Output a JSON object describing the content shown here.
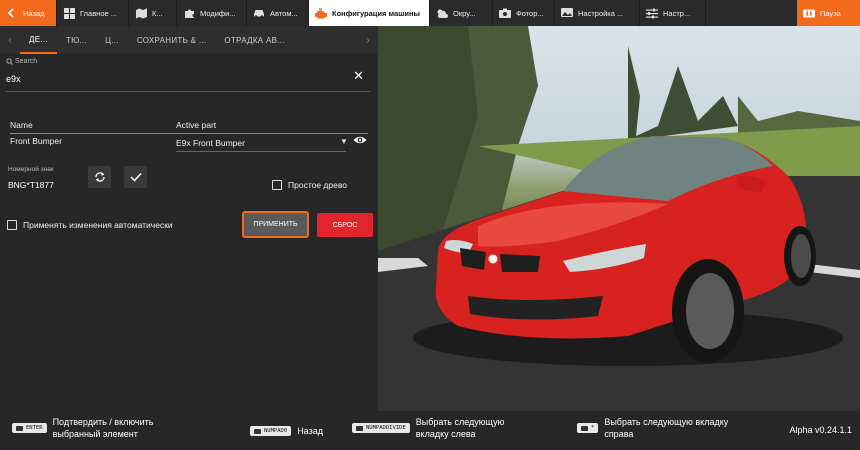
{
  "topbar": {
    "back": "Назад",
    "items": [
      {
        "label": "Главное ...",
        "icon": "grid-icon"
      },
      {
        "label": "К...",
        "icon": "map-icon"
      },
      {
        "label": "Модифи...",
        "icon": "puzzle-icon"
      },
      {
        "label": "Автом...",
        "icon": "car-icon"
      },
      {
        "label": "Конфигурация машины",
        "icon": "engine-icon"
      },
      {
        "label": "Окру...",
        "icon": "weather-icon"
      },
      {
        "label": "Фотор...",
        "icon": "camera-icon"
      },
      {
        "label": "Настройка ...",
        "icon": "photo-settings-icon"
      },
      {
        "label": "Настр...",
        "icon": "sliders-icon"
      }
    ],
    "pause": "Пауза"
  },
  "tabs": [
    "ДЕ...",
    "ТЮ...",
    "Ц...",
    "СОХРАНИТЬ & ...",
    "ОТРАДКА АВ..."
  ],
  "search": {
    "label": "Search",
    "value": "e9x"
  },
  "table": {
    "col_name": "Name",
    "col_part": "Active part",
    "row_name": "Front Bumper",
    "row_part": "E9x Front Bumper"
  },
  "plate": {
    "label": "Номерной знак",
    "value": "BNG*T1877"
  },
  "simple_tree": "Простое древо",
  "auto_apply": "Применять изменения автоматически",
  "apply_button": "ПРИМЕНИТЬ",
  "reset_button": "СБРОС",
  "hints": [
    {
      "key": "ENTER",
      "text": "Подтвердить / включить выбранный элемент"
    },
    {
      "key": "NUMPAD0",
      "text": "Назад"
    },
    {
      "key": "NUMPADDIVIDE",
      "text": "Выбрать следующую вкладку слева"
    },
    {
      "key": "*",
      "text": "Выбрать следующую вкладку справа"
    }
  ],
  "version": "Alpha v0.24.1.1",
  "colors": {
    "accent": "#f26a1b",
    "reset": "#e0262b",
    "car": "#d8221f"
  }
}
